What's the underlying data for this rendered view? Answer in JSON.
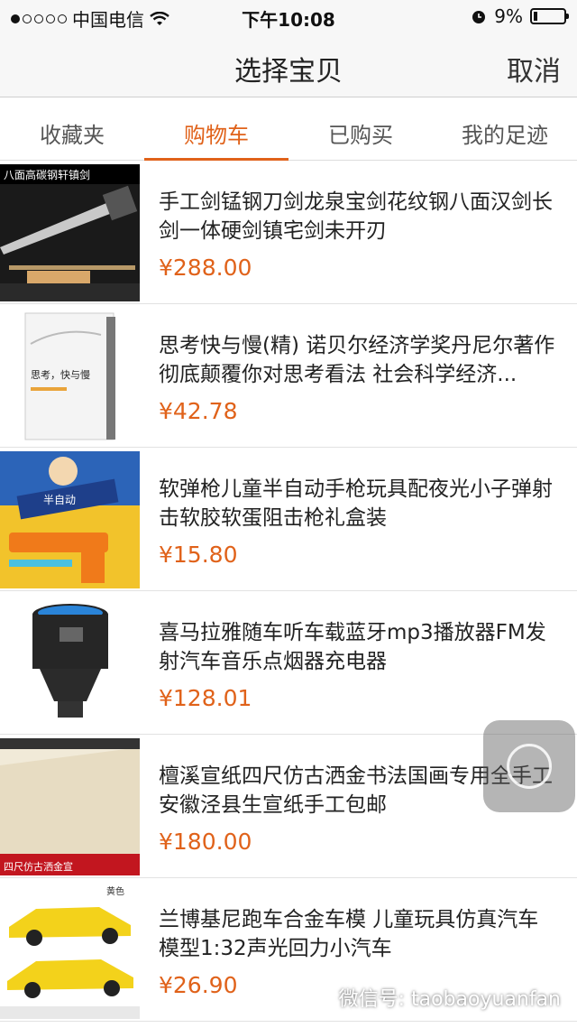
{
  "status_bar": {
    "carrier": "中国电信",
    "time": "下午10:08",
    "battery": "9%"
  },
  "nav": {
    "title": "选择宝贝",
    "cancel": "取消"
  },
  "tabs": [
    {
      "label": "收藏夹"
    },
    {
      "label": "购物车"
    },
    {
      "label": "已购买"
    },
    {
      "label": "我的足迹"
    }
  ],
  "items": [
    {
      "title": "手工剑锰钢刀剑龙泉宝剑花纹钢八面汉剑长剑一体硬剑镇宅剑未开刃",
      "price": "¥288.00",
      "thumb_text": "八面高碳钢轩镇剑"
    },
    {
      "title": "思考快与慢(精) 诺贝尔经济学奖丹尼尔著作 彻底颠覆你对思考看法 社会科学经济...",
      "price": "¥42.78",
      "thumb_text": "思考，快与慢"
    },
    {
      "title": "软弹枪儿童半自动手枪玩具配夜光小子弹射击软胶软蛋阻击枪礼盒装",
      "price": "¥15.80",
      "thumb_text": "半自动"
    },
    {
      "title": "喜马拉雅随车听车载蓝牙mp3播放器FM发射汽车音乐点烟器充电器",
      "price": "¥128.01",
      "thumb_text": ""
    },
    {
      "title": "檀溪宣纸四尺仿古洒金书法国画专用全手工安徽泾县生宣纸手工包邮",
      "price": "¥180.00",
      "thumb_text": "四尺仿古洒金宣"
    },
    {
      "title": "兰博基尼跑车合金车模 儿童玩具仿真汽车模型1:32声光回力小汽车",
      "price": "¥26.90",
      "thumb_text": "黄色"
    }
  ],
  "watermark": "微信号: taobaoyuanfan",
  "colors": {
    "accent": "#e0621a"
  }
}
